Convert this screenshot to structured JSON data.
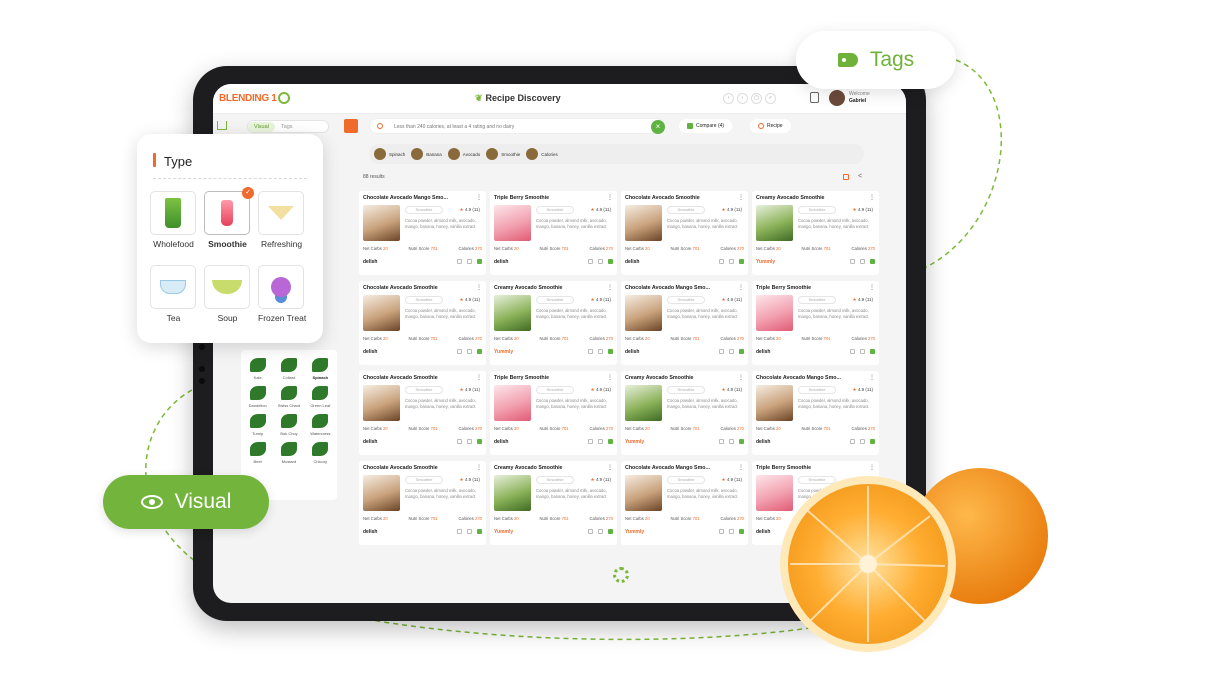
{
  "app": {
    "logo": "BLENDING 1",
    "title": "Recipe Discovery",
    "user_greeting": "Welcome",
    "user_name": "Gabriel"
  },
  "sidebar": {
    "toggle_visual": "Visual",
    "toggle_tags": "Tags",
    "ingredients": [
      {
        "label": "Kale",
        "selected": false
      },
      {
        "label": "Collard",
        "selected": false
      },
      {
        "label": "Spinach",
        "selected": true
      },
      {
        "label": "Dandelion",
        "selected": false
      },
      {
        "label": "Swiss Chard",
        "selected": false
      },
      {
        "label": "Green Leaf",
        "selected": false
      },
      {
        "label": "Turnip",
        "selected": false
      },
      {
        "label": "Bok Choy",
        "selected": false
      },
      {
        "label": "Watercress",
        "selected": false
      },
      {
        "label": "Beet",
        "selected": false
      },
      {
        "label": "Mustard",
        "selected": false
      },
      {
        "label": "Chicory",
        "selected": false
      }
    ]
  },
  "search": {
    "query": "Less than 240 calories, at least a 4 rating and no dairy",
    "compare_label": "Compare (4)",
    "recipe_label": "Recipe"
  },
  "filters": [
    "Spinach",
    "Banana",
    "Avocado",
    "Smoothie",
    "Calories"
  ],
  "results_count": "88 results",
  "card_labels": {
    "category": "Smoothie",
    "rating": "4.9 (11)",
    "description": "Cocoa powder, almond milk, avocado, mango, banana, honey, vanilla extract",
    "net_carbs_label": "Net Carbs",
    "net_carbs_value": "20",
    "nutri_label": "Nutri Score",
    "nutri_value": "701",
    "calories_label": "Calories",
    "calories_value": "270"
  },
  "recipes": [
    {
      "title": "Chocolate Avocado Mango Smo...",
      "img": "choc",
      "brand": "delish"
    },
    {
      "title": "Triple Berry Smoothie",
      "img": "berry",
      "brand": "delish"
    },
    {
      "title": "Chocolate Avocado Smoothie",
      "img": "choc",
      "brand": "delish"
    },
    {
      "title": "Creamy Avocado Smoothie",
      "img": "avo",
      "brand": "Yummly"
    },
    {
      "title": "Chocolate Avocado Smoothie",
      "img": "choc",
      "brand": "delish"
    },
    {
      "title": "Creamy Avocado Smoothie",
      "img": "avo",
      "brand": "Yummly"
    },
    {
      "title": "Chocolate Avocado Mango Smo...",
      "img": "choc",
      "brand": "delish"
    },
    {
      "title": "Triple Berry Smoothie",
      "img": "berry",
      "brand": "delish"
    },
    {
      "title": "Chocolate Avocado Smoothie",
      "img": "choc",
      "brand": "delish"
    },
    {
      "title": "Triple Berry Smoothie",
      "img": "berry",
      "brand": "delish"
    },
    {
      "title": "Creamy Avocado Smoothie",
      "img": "avo",
      "brand": "Yummly"
    },
    {
      "title": "Chocolate Avocado Mango Smo...",
      "img": "choc",
      "brand": "delish"
    },
    {
      "title": "Chocolate Avocado Smoothie",
      "img": "choc",
      "brand": "delish"
    },
    {
      "title": "Creamy Avocado Smoothie",
      "img": "avo",
      "brand": "Yummly"
    },
    {
      "title": "Chocolate Avocado Mango Smo...",
      "img": "choc",
      "brand": "Yummly"
    },
    {
      "title": "Triple Berry Smoothie",
      "img": "berry",
      "brand": "delish"
    }
  ],
  "type_panel": {
    "heading": "Type",
    "items": [
      {
        "label": "Wholefood",
        "glyph": "wholefood",
        "selected": false
      },
      {
        "label": "Smoothie",
        "glyph": "smoothie",
        "selected": true
      },
      {
        "label": "Refreshing",
        "glyph": "refresh",
        "selected": false
      },
      {
        "label": "Tea",
        "glyph": "tea",
        "selected": false
      },
      {
        "label": "Soup",
        "glyph": "soup",
        "selected": false
      },
      {
        "label": "Frozen Treat",
        "glyph": "frozen",
        "selected": false
      }
    ]
  },
  "callouts": {
    "tags": "Tags",
    "visual": "Visual"
  },
  "colors": {
    "brand_orange": "#ef6a2b",
    "brand_green": "#73b53c"
  }
}
